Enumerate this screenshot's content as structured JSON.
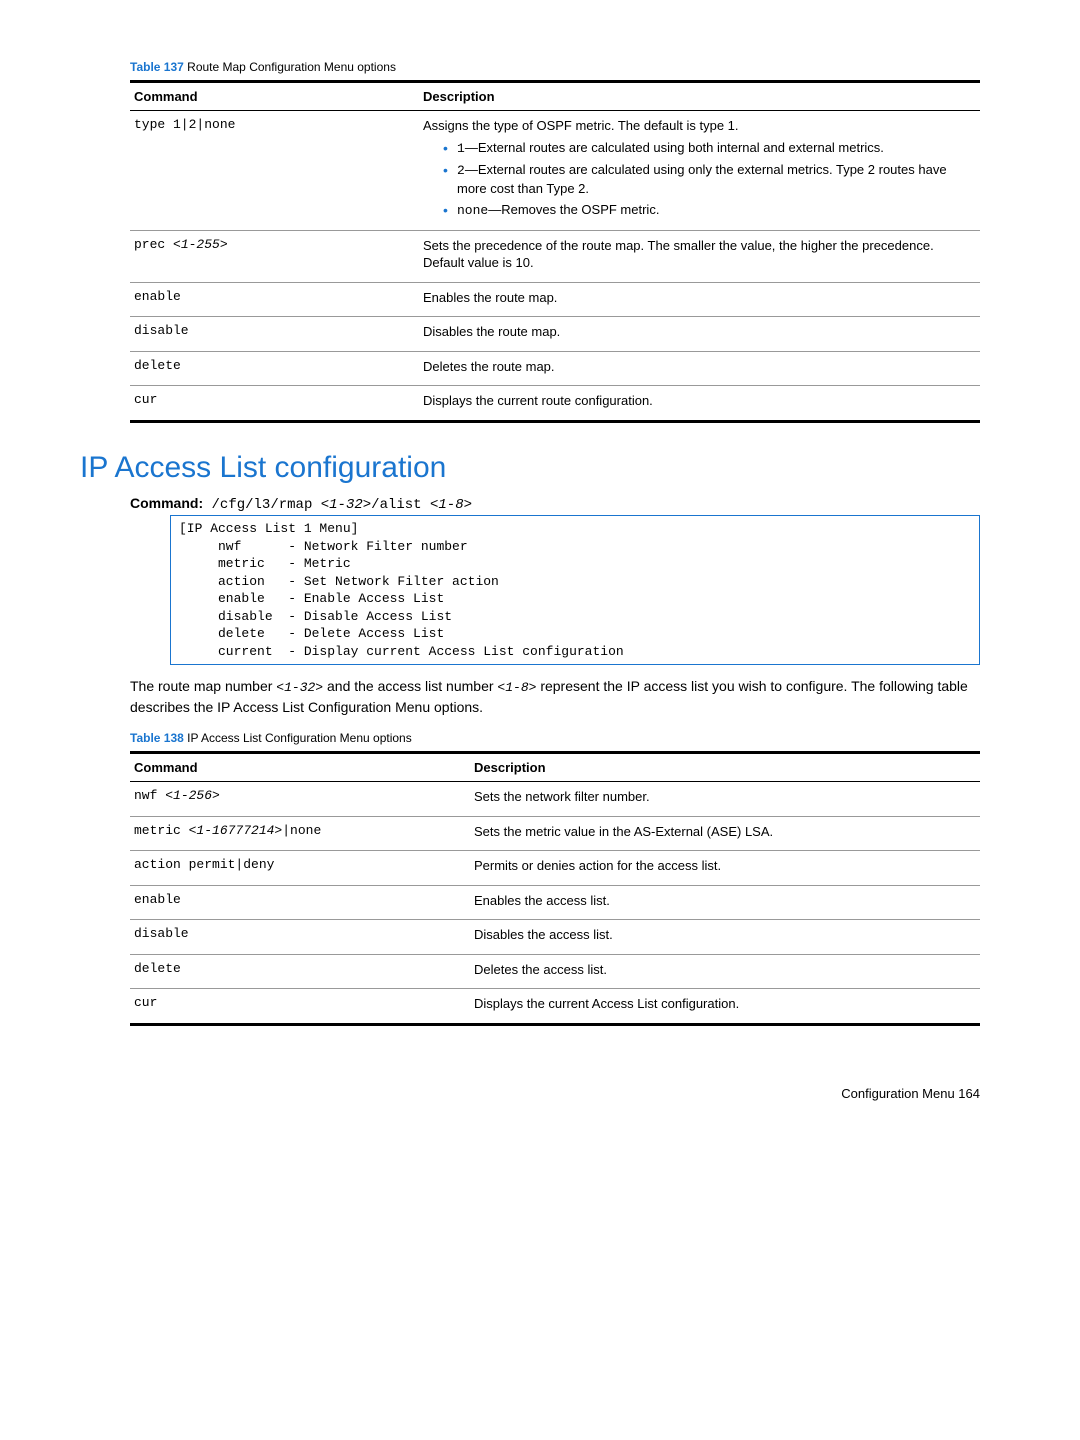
{
  "table137": {
    "caption_label": "Table 137",
    "caption_text": "Route Map Configuration Menu options",
    "col1": "Command",
    "col2": "Description",
    "r1_cmd": "type 1|2|none",
    "r1_p1": "Assigns the type of OSPF metric. The default is type 1.",
    "r1_li1_code": "1",
    "r1_li1_rest": "—External routes are calculated using both internal and external metrics.",
    "r1_li2_code": "2",
    "r1_li2_rest": "—External routes are calculated using only the external metrics. Type 2 routes have more cost than Type 2.",
    "r1_li3_code": "none",
    "r1_li3_rest": "—Removes the OSPF metric.",
    "r2_cmd_a": "prec ",
    "r2_cmd_b": "<1-255>",
    "r2_desc": "Sets the precedence of the route map. The smaller the value, the higher the precedence. Default value is 10.",
    "r3_cmd": "enable",
    "r3_desc": "Enables the route map.",
    "r4_cmd": "disable",
    "r4_desc": "Disables the route map.",
    "r5_cmd": "delete",
    "r5_desc": "Deletes the route map.",
    "r6_cmd": "cur",
    "r6_desc": "Displays the current route configuration."
  },
  "section_title": "IP Access List configuration",
  "cmdline": {
    "label": "Command:",
    "p1": " /cfg/l3/rmap ",
    "a1": "<1-32>",
    "p2": "/alist ",
    "a2": "<1-8>"
  },
  "codebox": "[IP Access List 1 Menu]\n     nwf      - Network Filter number\n     metric   - Metric\n     action   - Set Network Filter action\n     enable   - Enable Access List\n     disable  - Disable Access List\n     delete   - Delete Access List\n     current  - Display current Access List configuration",
  "para": {
    "p1": "The route map number ",
    "a1": "<1-32>",
    "p2": " and the access list number ",
    "a2": "<1-8>",
    "p3": " represent the IP access list you wish to configure. The following table describes the IP Access List Configuration Menu options."
  },
  "table138": {
    "caption_label": "Table 138",
    "caption_text": "IP Access List Configuration Menu options",
    "col1": "Command",
    "col2": "Description",
    "r1_cmd_a": "nwf ",
    "r1_cmd_b": "<1-256>",
    "r1_desc": "Sets the network filter number.",
    "r2_cmd_a": "metric ",
    "r2_cmd_b": "<1-16777214>",
    "r2_cmd_c": "|none",
    "r2_desc": "Sets the metric value in the AS-External (ASE) LSA.",
    "r3_cmd": "action permit|deny",
    "r3_desc": "Permits or denies action for the access list.",
    "r4_cmd": "enable",
    "r4_desc": "Enables the access list.",
    "r5_cmd": "disable",
    "r5_desc": "Disables the access list.",
    "r6_cmd": "delete",
    "r6_desc": "Deletes the access list.",
    "r7_cmd": "cur",
    "r7_desc": "Displays the current Access List configuration."
  },
  "footer": "Configuration Menu   164"
}
